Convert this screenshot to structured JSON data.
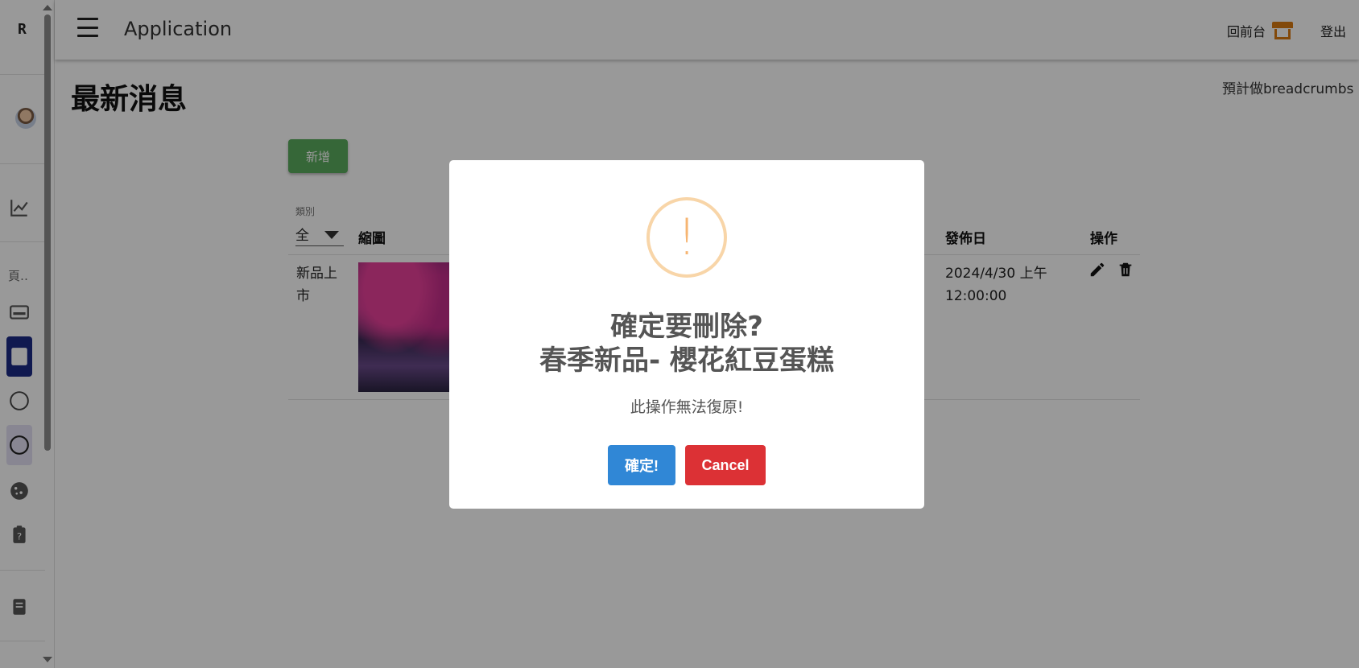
{
  "rail": {
    "logo": "R",
    "group_label": "頁‥"
  },
  "appbar": {
    "title": "Application",
    "front_link": "回前台",
    "logout": "登出"
  },
  "page": {
    "title": "最新消息",
    "breadcrumb": "預計做breadcrumbs",
    "add_button": "新增"
  },
  "filter": {
    "label": "類別",
    "value": "全"
  },
  "table": {
    "headers": [
      "縮圖",
      "發佈日",
      "操作"
    ],
    "rows": [
      {
        "category": [
          "新品上",
          "市"
        ],
        "date": [
          "2024/4/30 上午",
          "12:00:00"
        ]
      }
    ]
  },
  "dialog": {
    "icon": "!",
    "title_line1": "確定要刪除?",
    "title_line2": "春季新品- 櫻花紅豆蛋糕",
    "text": "此操作無法復原!",
    "confirm": "確定!",
    "cancel": "Cancel"
  },
  "colors": {
    "confirm": "#3087d6",
    "cancel": "#dc3135",
    "add": "#5aac5e",
    "warning": "#f6b572",
    "active_nav": "#1c2a86",
    "store_icon": "#d97a12"
  }
}
